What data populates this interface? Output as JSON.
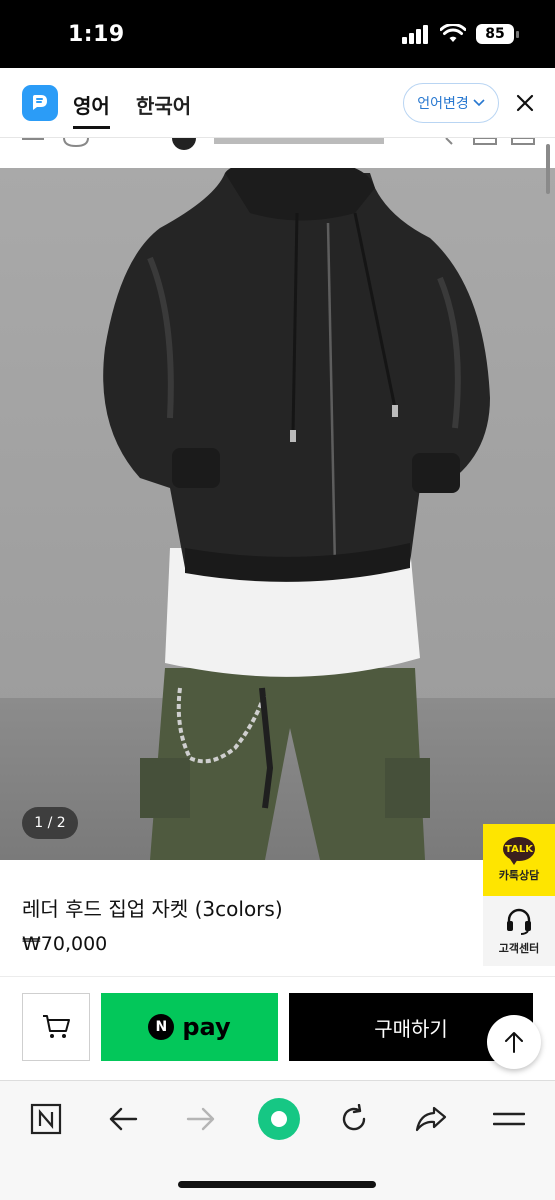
{
  "status_bar": {
    "time": "1:19",
    "battery": "85"
  },
  "translate_bar": {
    "source_lang": "영어",
    "target_lang": "한국어",
    "change_button": "언어변경",
    "icons": [
      "papago-logo-icon",
      "chevron-down-icon",
      "close-icon"
    ]
  },
  "product": {
    "image_counter": "1 / 2",
    "name": "레더 후드 집업 자켓 (3colors)",
    "price": "₩70,000"
  },
  "floating": {
    "kakao_badge": "TALK",
    "kakao_label": "카톡상담",
    "cs_label": "고객센터"
  },
  "purchase": {
    "npay_logo": "N",
    "npay_label": "pay",
    "buy_label": "구매하기"
  },
  "toolbar": {
    "icons": [
      "naver-home-icon",
      "back-arrow-icon",
      "forward-arrow-icon",
      "green-dot-icon",
      "refresh-icon",
      "share-icon",
      "menu-icon"
    ]
  },
  "colors": {
    "npay_green": "#03c75a",
    "kakao_yellow": "#fee500",
    "papago_blue": "#2b9cf7",
    "link_blue": "#2878d0",
    "toolbar_green": "#16c784"
  }
}
